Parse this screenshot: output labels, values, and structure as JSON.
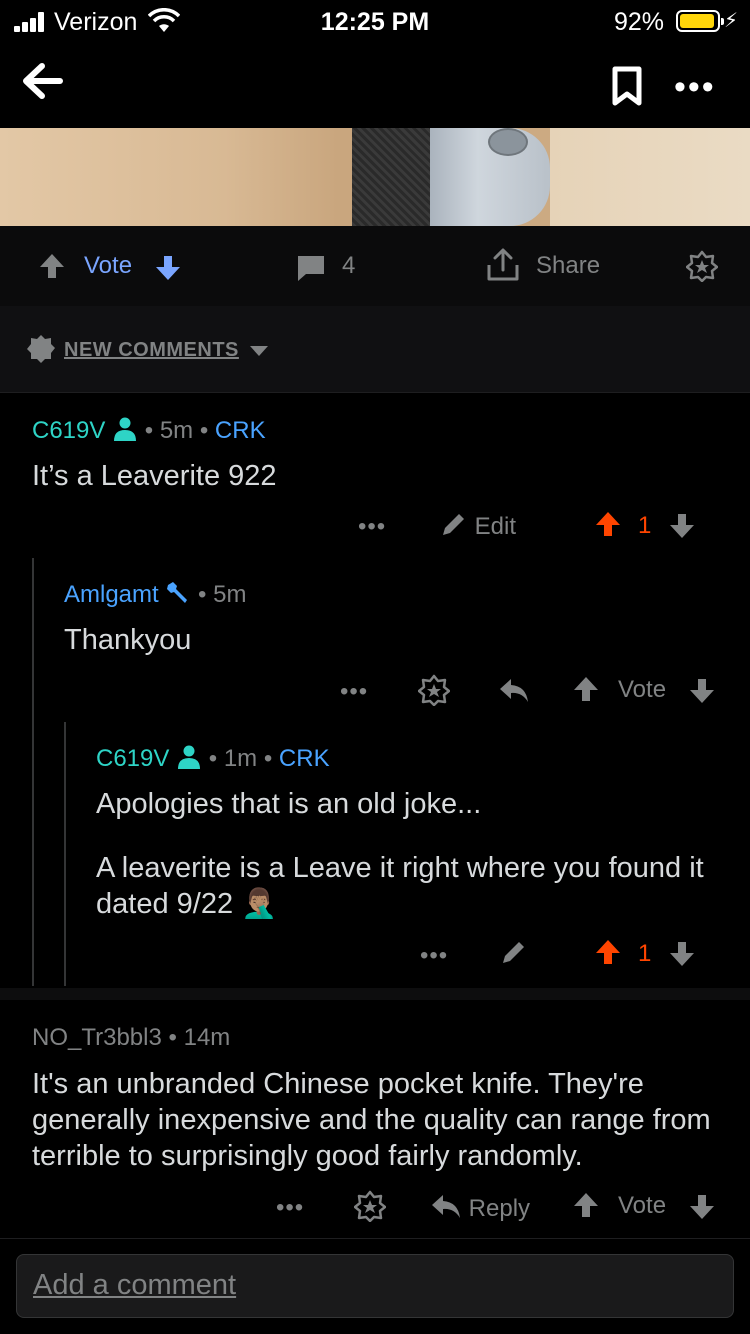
{
  "status_bar": {
    "carrier": "Verizon",
    "time": "12:25 PM",
    "battery": "92%"
  },
  "post_actions": {
    "vote_label": "Vote",
    "comment_count": "4",
    "share_label": "Share"
  },
  "sort": {
    "label": "NEW COMMENTS"
  },
  "comments": [
    {
      "author": "C619V",
      "time": "5m",
      "flair": "CRK",
      "separator": "•",
      "body": "It’s a Leaverite 922",
      "edit_label": "Edit",
      "score": "1"
    },
    {
      "author": "Amlgamt",
      "time": "5m",
      "separator": "•",
      "body": "Thankyou",
      "vote_label": "Vote"
    },
    {
      "author": "C619V",
      "time": "1m",
      "flair": "CRK",
      "separator": "•",
      "body_p1": "Apologies that is an old joke...",
      "body_p2": "A leaverite is a Leave it right where you found it dated 9/22",
      "emoji": "🤦🏽‍♂️",
      "score": "1"
    },
    {
      "author": "NO_Tr3bbl3",
      "time": "14m",
      "separator": "•",
      "body": "It's an unbranded Chinese pocket knife. They're generally inexpensive and the quality can range from terrible to surprisingly good fairly randomly.",
      "reply_label": "Reply",
      "vote_label": "Vote"
    }
  ],
  "more_label": "•••",
  "comment_input": {
    "placeholder": "Add a comment"
  },
  "colors": {
    "upvote_active": "#ff4500",
    "vote_blue": "#7aa5ff",
    "username_green": "#2ed4c6",
    "link_blue": "#4aa3ff"
  }
}
